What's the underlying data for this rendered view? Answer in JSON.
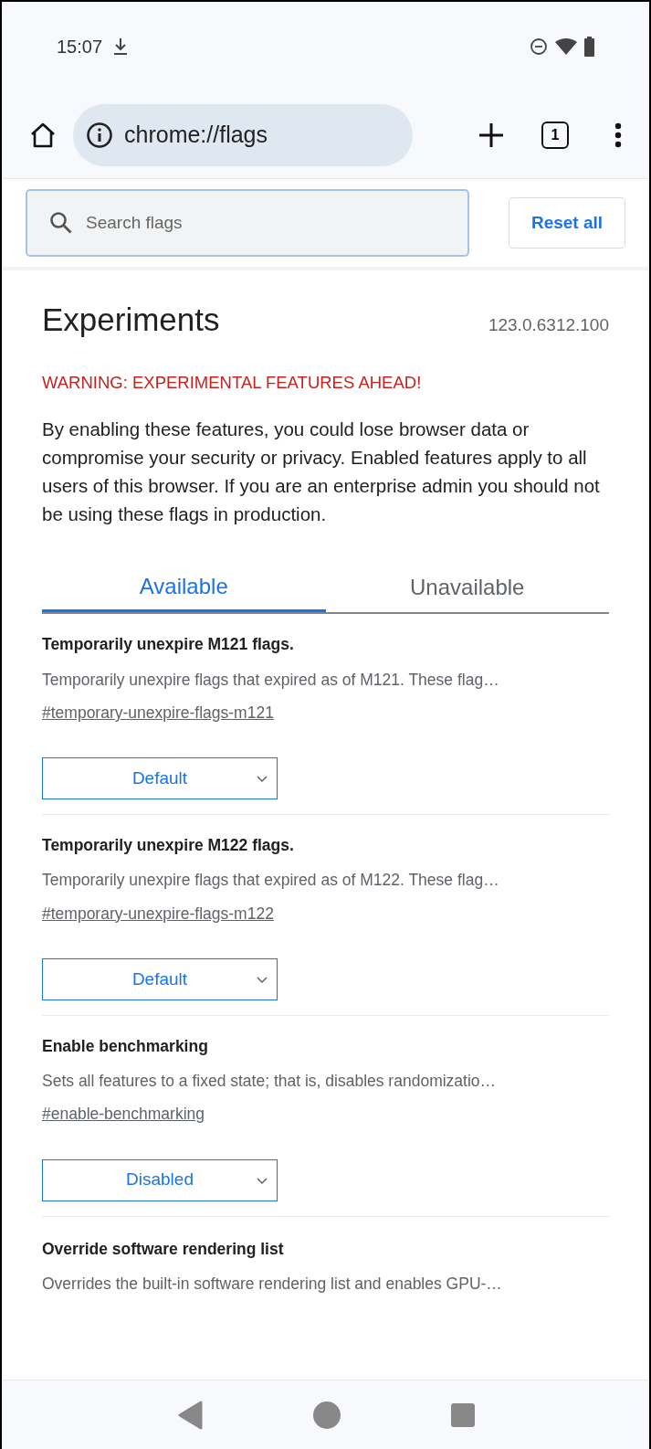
{
  "status_bar": {
    "time": "15:07"
  },
  "toolbar": {
    "url": "chrome://flags",
    "tab_count": "1"
  },
  "search": {
    "placeholder": "Search flags"
  },
  "reset_button": "Reset all",
  "page": {
    "title": "Experiments",
    "version": "123.0.6312.100",
    "warning": "WARNING: EXPERIMENTAL FEATURES AHEAD!",
    "intro": "By enabling these features, you could lose browser data or compromise your security or privacy. Enabled features apply to all users of this browser. If you are an enterprise admin you should not be using these flags in production."
  },
  "tabs": [
    {
      "label": "Available",
      "selected": true
    },
    {
      "label": "Unavailable",
      "selected": false
    }
  ],
  "flags": [
    {
      "title": "Temporarily unexpire M121 flags.",
      "description": "Temporarily unexpire flags that expired as of M121. These flag…",
      "link": "#temporary-unexpire-flags-m121",
      "value": "Default"
    },
    {
      "title": "Temporarily unexpire M122 flags.",
      "description": "Temporarily unexpire flags that expired as of M122. These flag…",
      "link": "#temporary-unexpire-flags-m122",
      "value": "Default"
    },
    {
      "title": "Enable benchmarking",
      "description": "Sets all features to a fixed state; that is, disables randomizatio…",
      "link": "#enable-benchmarking",
      "value": "Disabled"
    },
    {
      "title": "Override software rendering list",
      "description": "Overrides the built-in software rendering list and enables GPU-…"
    }
  ]
}
